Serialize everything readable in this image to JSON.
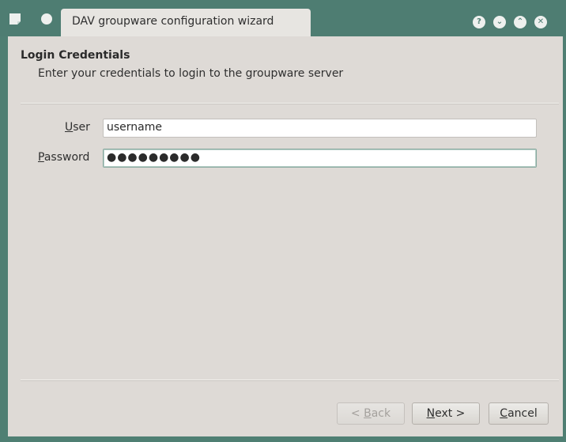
{
  "window": {
    "title": "DAV groupware configuration wizard",
    "accent": "#4e7d72"
  },
  "titlebar": {
    "left_icons": [
      "app-icon",
      "menu-icon"
    ],
    "right_buttons": {
      "help": "?",
      "minimize": "⌄",
      "maximize": "⌃",
      "close": "✕"
    }
  },
  "header": {
    "title": "Login Credentials",
    "subtitle": "Enter your credentials to login to the groupware server"
  },
  "form": {
    "user": {
      "label_prefix": "",
      "label_mnemonic": "U",
      "label_rest": "ser",
      "value": "username"
    },
    "password": {
      "label_prefix": "",
      "label_mnemonic": "P",
      "label_rest": "assword",
      "value": "●●●●●●●●●"
    }
  },
  "buttons": {
    "back_prefix": "< ",
    "back_mnemonic": "B",
    "back_rest": "ack",
    "next_mnemonic": "N",
    "next_rest": "ext >",
    "cancel_mnemonic": "C",
    "cancel_rest": "ancel"
  }
}
